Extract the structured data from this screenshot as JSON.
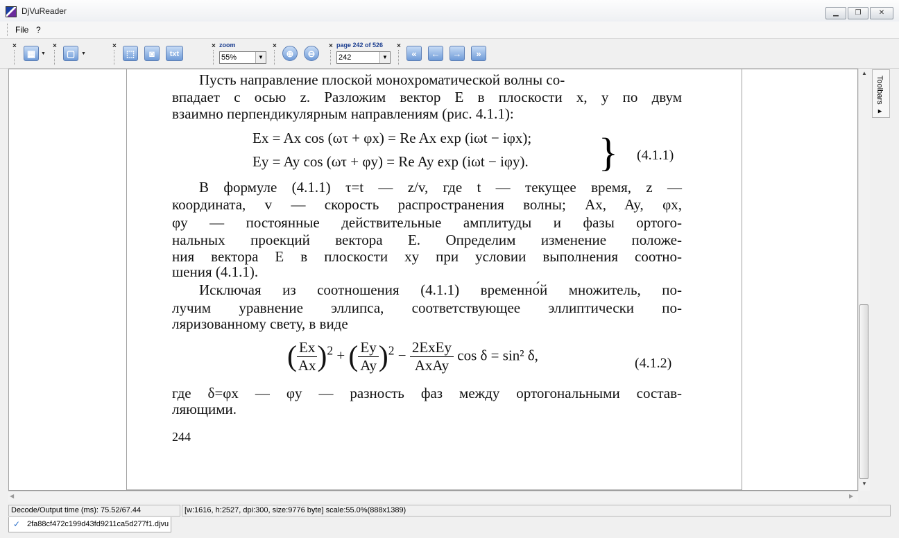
{
  "window": {
    "title": "DjVuReader"
  },
  "menu": {
    "file": "File",
    "help": "?"
  },
  "toolbar": {
    "close_glyph": "×",
    "zoom_label": "zoom",
    "zoom_value": "55%",
    "page_label": "page 242 of 526",
    "page_value": "242",
    "txt_label": "txt"
  },
  "side_panel": {
    "label": "Toolbars ▸"
  },
  "document": {
    "lines": [
      "Пусть направление плоской монохроматической волны со-",
      "впадает с осью z. Разложим вектор E в плоскости x, y по двум",
      "взаимно перпендикулярным направлениям (рис. 4.1.1):",
      "В формуле (4.1.1) τ=t — z/v, где t — текущее время, z —",
      "координата, v — скорость распространения волны; Ax, Ay, φx,",
      "φy — постоянные действительные амплитуды и фазы ортого-",
      "нальных проекций вектора E. Определим изменение положе-",
      "ния вектора E в плоскости xy при условии выполнения соотно-",
      "шения (4.1.1).",
      "Исключая из соотношения (4.1.1) временно́й множитель, по-",
      "лучим уравнение эллипса, соответствующее эллиптически по-",
      "ляризованному свету, в виде",
      "где δ=φx — φy — разность фаз между ортогональными состав-",
      "ляющими."
    ],
    "eq1_line1": "Ex = Ax cos (ωτ + φx) = Re Ax exp (iωt − iφx);",
    "eq1_line2": "Ey = Ay cos (ωτ + φy) = Re Ay exp (iωt − iφy).",
    "eq1_number": "(4.1.1)",
    "eq2_f1_num": "Ex",
    "eq2_f1_den": "Ax",
    "eq2_f2_num": "Ey",
    "eq2_f2_den": "Ay",
    "eq2_f3_num": "2ExEy",
    "eq2_f3_den": "AxAy",
    "eq2_tail": "cos δ = sin² δ,",
    "eq2_number": "(4.1.2)",
    "page_number": "244"
  },
  "status": {
    "decode": "Decode/Output time (ms): 75.52/67.44",
    "info": "[w:1616, h:2527, dpi:300, size:9776 byte] scale:55.0%(888x1389)"
  },
  "tab": {
    "filename": "2fa88cf472c199d43fd9211ca5d277f1.djvu"
  }
}
